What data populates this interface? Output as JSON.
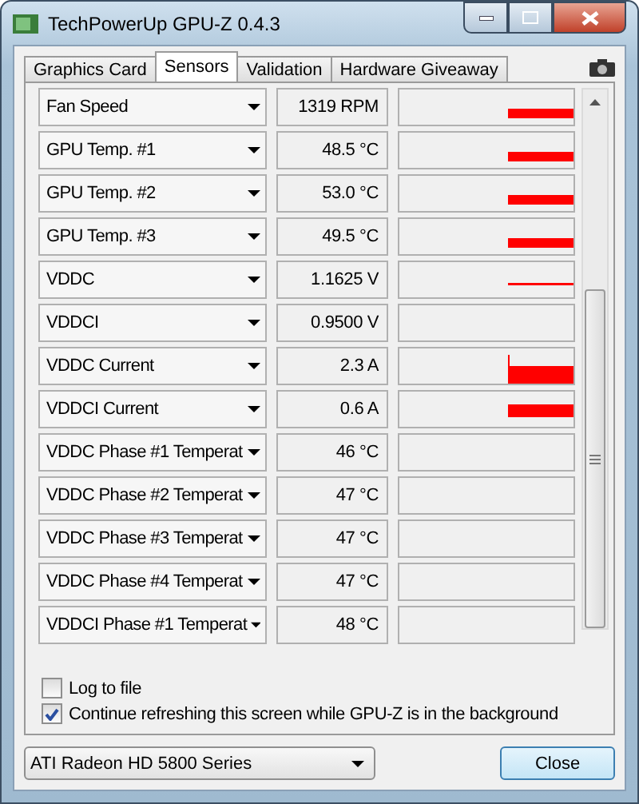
{
  "window": {
    "title": "TechPowerUp GPU-Z 0.4.3"
  },
  "tabs": [
    {
      "label": "Graphics Card",
      "selected": false
    },
    {
      "label": "Sensors",
      "selected": true
    },
    {
      "label": "Validation",
      "selected": false
    },
    {
      "label": "Hardware Giveaway",
      "selected": false
    }
  ],
  "sensors": [
    {
      "name": "Fan Speed",
      "value": "1319 RPM",
      "kind": "bar"
    },
    {
      "name": "GPU Temp. #1",
      "value": "48.5 °C",
      "kind": "bar"
    },
    {
      "name": "GPU Temp. #2",
      "value": "53.0 °C",
      "kind": "bar"
    },
    {
      "name": "GPU Temp. #3",
      "value": "49.5 °C",
      "kind": "bar"
    },
    {
      "name": "VDDC",
      "value": "1.1625 V",
      "kind": "line"
    },
    {
      "name": "VDDCI",
      "value": "0.9500 V",
      "kind": "empty"
    },
    {
      "name": "VDDC Current",
      "value": "2.3 A",
      "kind": "spike"
    },
    {
      "name": "VDDCI Current",
      "value": "0.6 A",
      "kind": "block"
    },
    {
      "name": "VDDC Phase #1 Temperat",
      "value": "46 °C",
      "kind": "empty"
    },
    {
      "name": "VDDC Phase #2 Temperat",
      "value": "47 °C",
      "kind": "empty"
    },
    {
      "name": "VDDC Phase #3 Temperat",
      "value": "47 °C",
      "kind": "empty"
    },
    {
      "name": "VDDC Phase #4 Temperat",
      "value": "47 °C",
      "kind": "empty"
    },
    {
      "name": "VDDCI Phase #1 Temperat",
      "value": "48 °C",
      "kind": "empty"
    }
  ],
  "options": [
    {
      "label": "Log to file",
      "checked": false
    },
    {
      "label": "Continue refreshing this screen while GPU-Z is in the background",
      "checked": true
    }
  ],
  "device_select": {
    "value": "ATI Radeon HD 5800 Series"
  },
  "buttons": [
    "Close"
  ]
}
